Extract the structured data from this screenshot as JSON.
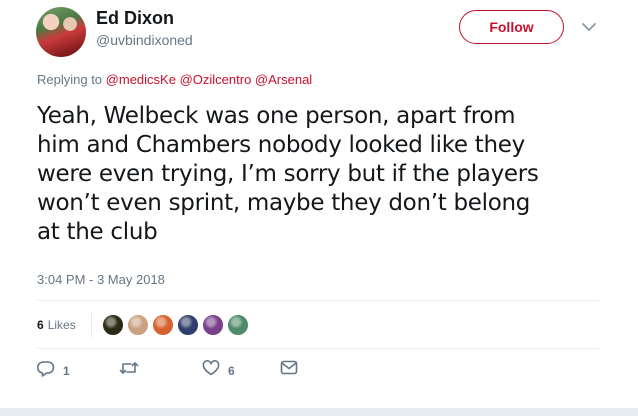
{
  "user": {
    "name": "Ed Dixon",
    "handle": "@uvbindixoned",
    "follow_label": "Follow"
  },
  "reply": {
    "prefix": "Replying to",
    "mentions": [
      "@medicsKe",
      "@Ozilcentro",
      "@Arsenal"
    ]
  },
  "tweet": {
    "lines": [
      "Yeah, Welbeck was one person, apart from",
      "him and Chambers nobody looked like they",
      "were even trying, I’m sorry but if the players",
      "won’t even sprint, maybe they don’t belong",
      "at the club"
    ],
    "timestamp": "3:04 PM - 3 May 2018"
  },
  "likes": {
    "count": "6",
    "label": "Likes",
    "avatar_colors": [
      "#2b2a14",
      "#c9a27f",
      "#d6622f",
      "#2f3f6b",
      "#7a3f8a",
      "#4e8a6a"
    ]
  },
  "actions": {
    "reply_icon": "reply-icon",
    "reply_count": "1",
    "retweet_icon": "retweet-icon",
    "like_icon": "heart-icon",
    "like_count": "6",
    "dm_icon": "envelope-icon"
  },
  "colors": {
    "accent": "#c8102e",
    "muted": "#657786",
    "text": "#14171a",
    "divider": "#e6ecf0"
  }
}
